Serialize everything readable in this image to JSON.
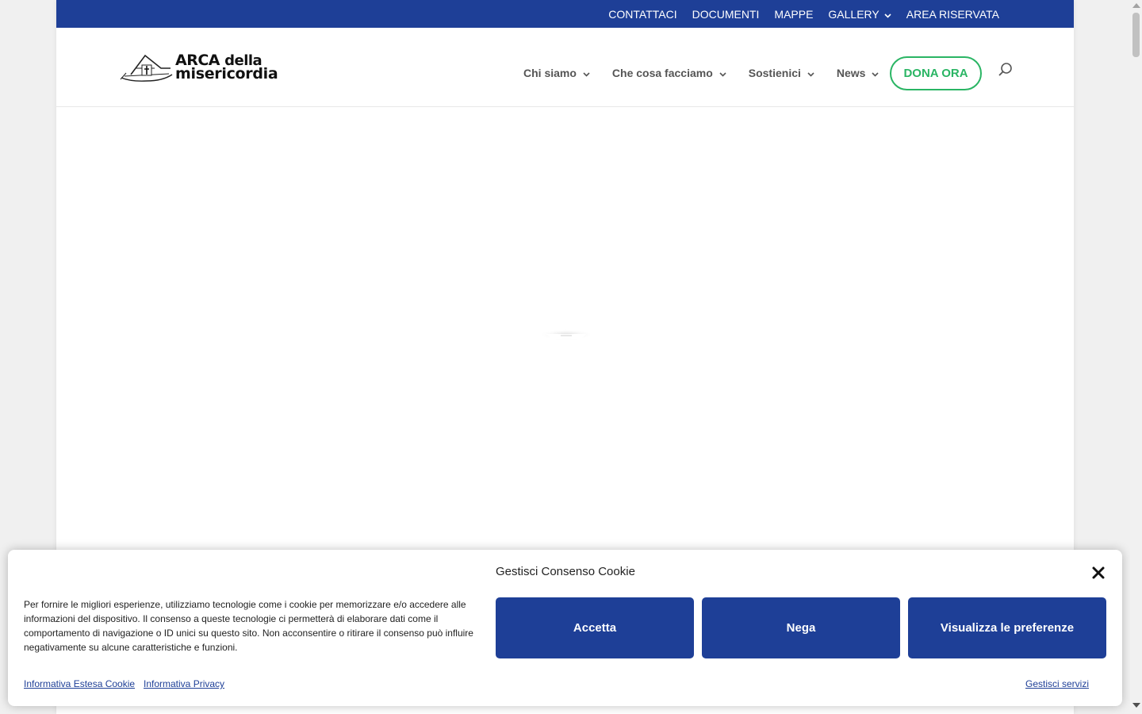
{
  "topbar": {
    "items": [
      {
        "label": "CONTATTACI"
      },
      {
        "label": "DOCUMENTI"
      },
      {
        "label": "MAPPE"
      },
      {
        "label": "GALLERY",
        "has_dropdown": true
      },
      {
        "label": "AREA RISERVATA"
      }
    ],
    "background_color": "#1e3f97"
  },
  "logo": {
    "line1_main": "ARCA",
    "line1_small": "della",
    "line2": "misericordia",
    "icon": "ark-logo-icon"
  },
  "mainnav": {
    "items": [
      {
        "label": "Chi siamo",
        "has_dropdown": true
      },
      {
        "label": "Che cosa facciamo",
        "has_dropdown": true
      },
      {
        "label": "Sostienici",
        "has_dropdown": true
      },
      {
        "label": "News",
        "has_dropdown": true
      }
    ],
    "donate_label": "DONA ORA",
    "donate_color": "#2ab564",
    "search_icon": "search-icon"
  },
  "cookie": {
    "title": "Gestisci Consenso Cookie",
    "text": "Per fornire le migliori esperienze, utilizziamo tecnologie come i cookie per memorizzare e/o accedere alle informazioni del dispositivo. Il consenso a queste tecnologie ci permetterà di elaborare dati come il comportamento di navigazione o ID unici su questo sito. Non acconsentire o ritirare il consenso può influire negativamente su alcune caratteristiche e funzioni.",
    "accept_label": "Accetta",
    "deny_label": "Nega",
    "prefs_label": "Visualizza le preferenze",
    "link_cookie": "Informativa Estesa Cookie",
    "link_privacy": "Informativa Privacy",
    "link_manage": "Gestisci servizi",
    "button_color": "#1e3f97"
  }
}
